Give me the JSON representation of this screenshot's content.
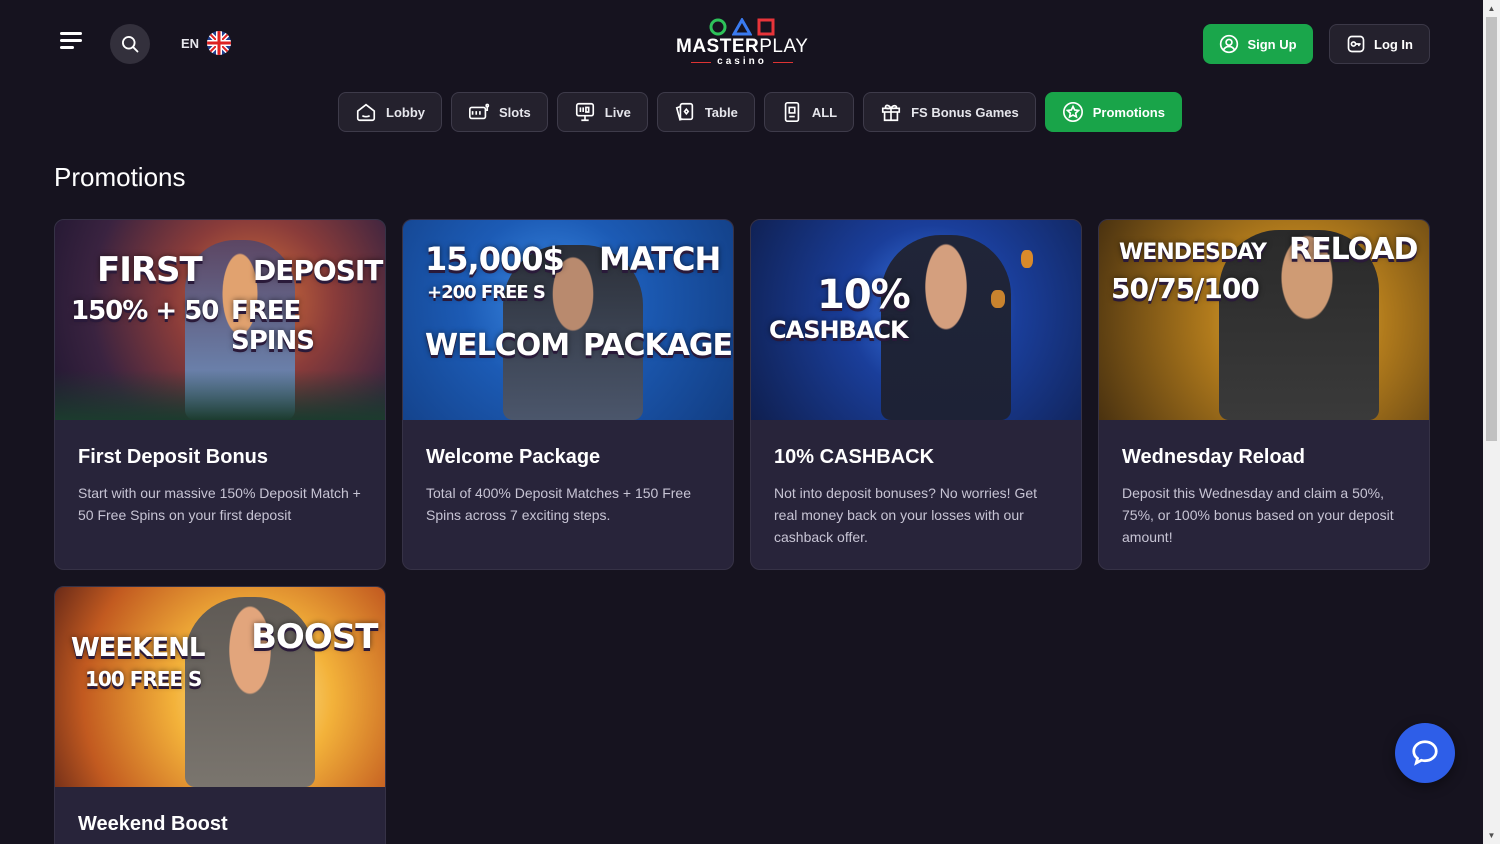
{
  "header": {
    "lang_code": "EN",
    "logo": {
      "brand_bold": "MASTER",
      "brand_thin": "PLAY",
      "sub": "casino"
    },
    "signup_label": "Sign Up",
    "login_label": "Log In"
  },
  "nav": {
    "items": [
      {
        "label": "Lobby",
        "icon": "home-icon"
      },
      {
        "label": "Slots",
        "icon": "slot-machine-icon"
      },
      {
        "label": "Live",
        "icon": "live-icon"
      },
      {
        "label": "Table",
        "icon": "cards-icon"
      },
      {
        "label": "ALL",
        "icon": "phone-icon"
      },
      {
        "label": "FS Bonus Games",
        "icon": "gift-icon"
      },
      {
        "label": "Promotions",
        "icon": "star-icon",
        "active": true
      }
    ]
  },
  "page": {
    "title": "Promotions"
  },
  "promotions": [
    {
      "title": "First Deposit Bonus",
      "description": "Start with our massive 150% Deposit Match + 50 Free Spins on your first deposit",
      "banner": {
        "line1a": "FIRST",
        "line1b": "DEPOSIT",
        "line2a": "150% + 50",
        "line2b": "FREE SPINS"
      }
    },
    {
      "title": "Welcome Package",
      "description": "Total of 400% Deposit Matches + 150 Free Spins across 7 exciting steps.",
      "banner": {
        "line1a": "15,000$",
        "line1b": "MATCH",
        "line2a": "+200 FREE S",
        "line3a": "WELCOM",
        "line3b": "PACKAGE"
      }
    },
    {
      "title": "10% CASHBACK",
      "description": "Not into deposit bonuses? No worries! Get real money back on your losses with our cashback offer.",
      "banner": {
        "line1a": "10%",
        "line2a": "CASHBACK"
      }
    },
    {
      "title": "Wednesday Reload",
      "description": "Deposit this Wednesday and claim a 50%, 75%, or 100% bonus based on your deposit amount!",
      "banner": {
        "line1a": "WENDESDAY",
        "line1b": "RELOAD",
        "line2a": "50/75/100"
      }
    },
    {
      "title": "Weekend Boost",
      "description": "",
      "banner": {
        "line1a": "WEEKENL",
        "line1b": "BOOST",
        "line2a": "100 FREE S"
      }
    }
  ],
  "colors": {
    "background": "#16131f",
    "accent_green": "#1aa64b",
    "card": "#28243a",
    "chat": "#2e5ee8"
  }
}
